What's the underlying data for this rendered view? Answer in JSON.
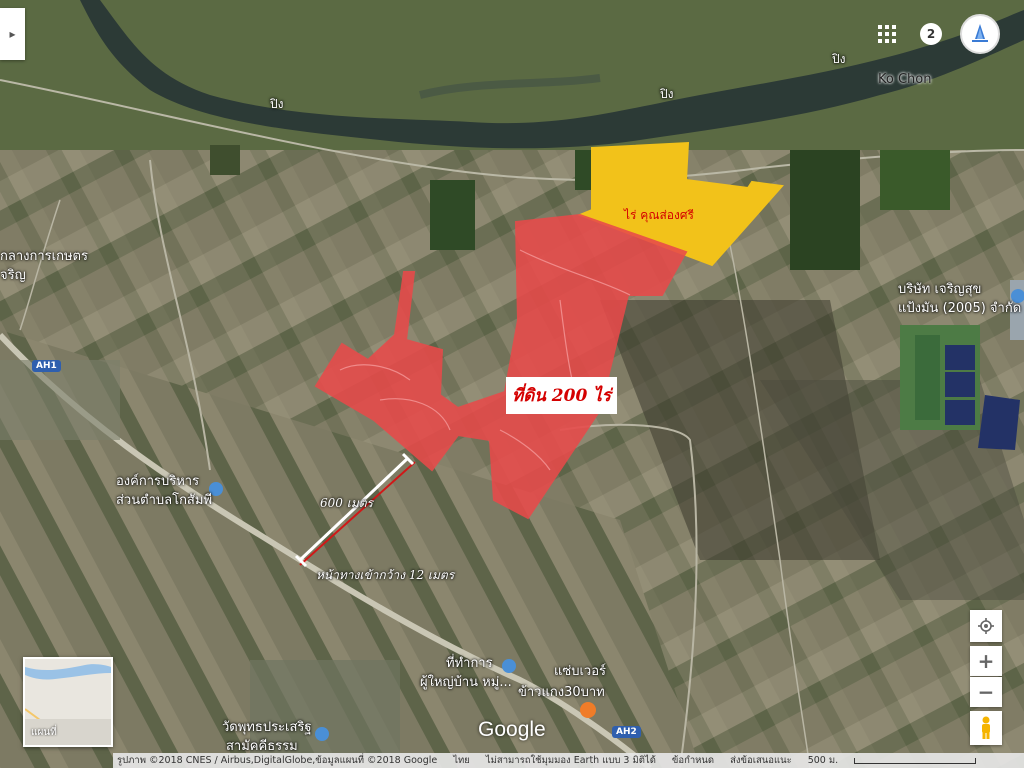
{
  "header": {
    "side_panel_toggle": "▸",
    "apps_icon": "apps-grid-icon",
    "notification_count": "2"
  },
  "annotations": {
    "plot_200_label": "ที่ดิน 200 ไร่",
    "neighbor_plot_label": "ไร่ คุณส่องศรี",
    "distance_label": "600 เมตร",
    "road_width_label": "หน้าทางเข้ากว้าง 12 เมตร",
    "plot_color": "#e84a4a",
    "neighbor_color": "#f2c21a"
  },
  "places": {
    "ko_chon": "Ko Chon",
    "river_1": "ปิง",
    "river_2": "ปิง",
    "river_3": "ปิง",
    "agri_center_1": "กลางการเกษตร",
    "agri_center_2": "จริญ",
    "company_1": "บริษัท เจริญสุข",
    "company_2": "แป้งมัน (2005) จำกัด",
    "sao_1": "องค์การบริหาร",
    "sao_2": "ส่วนตำบลโกสัมพี",
    "office_1": "ที่ทำการ",
    "office_2": "ผู้ใหญ่บ้าน หมู่...",
    "shop_1": "แซ่บเวอร์",
    "shop_2": "ข้าวแกง30บาท",
    "temple_1": "วัดพุทธประเสริฐ",
    "temple_2": "สามัคคีธรรม",
    "route_ah1": "AH1",
    "route_ah2": "AH2"
  },
  "controls": {
    "zoom_in": "+",
    "zoom_out": "−",
    "minimap_label": "แผนที่"
  },
  "branding": {
    "logo": "Google"
  },
  "footer": {
    "imagery": "รูปภาพ ©2018 CNES / Airbus,DigitalGlobe,ข้อมูลแผนที่ ©2018 Google",
    "language": "ไทย",
    "earth_notice": "ไม่สามารถใช้มุมมอง Earth แบบ 3 มิติได้",
    "terms": "ข้อกำหนด",
    "feedback": "ส่งข้อเสนอแนะ",
    "scale": "500 ม."
  }
}
